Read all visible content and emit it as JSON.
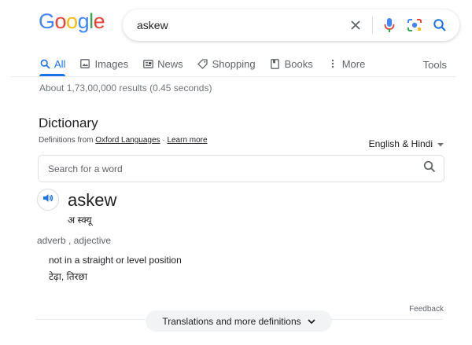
{
  "logo": {
    "letters": [
      "G",
      "o",
      "o",
      "g",
      "l",
      "e"
    ],
    "colors": [
      "#4285F4",
      "#EA4335",
      "#FBBC05",
      "#4285F4",
      "#34A853",
      "#EA4335"
    ]
  },
  "search": {
    "query": "askew"
  },
  "tabs": [
    {
      "label": "All",
      "icon": "search-icon",
      "active": true
    },
    {
      "label": "Images",
      "icon": "image-icon"
    },
    {
      "label": "News",
      "icon": "news-icon"
    },
    {
      "label": "Shopping",
      "icon": "tag-icon"
    },
    {
      "label": "Books",
      "icon": "book-icon"
    },
    {
      "label": "More",
      "icon": "dots-vertical-icon"
    }
  ],
  "tools_label": "Tools",
  "result_stats": "About 1,73,00,000 results (0.45 seconds)",
  "dictionary": {
    "title": "Dictionary",
    "source_prefix": "Definitions from",
    "source_name": "Oxford Languages",
    "source_sep": "·",
    "learn_more": "Learn more",
    "language_select": "English & Hindi",
    "word_search_placeholder": "Search for a word",
    "headword": "askew",
    "pronunciation": "अ स्क्यू",
    "part_of_speech": "adverb , adjective",
    "definition": "not in a straight or level position",
    "translation": "टेढ़ा, तिरछा",
    "feedback": "Feedback",
    "more_button": "Translations and more definitions"
  },
  "accent_color": "#1a73e8"
}
